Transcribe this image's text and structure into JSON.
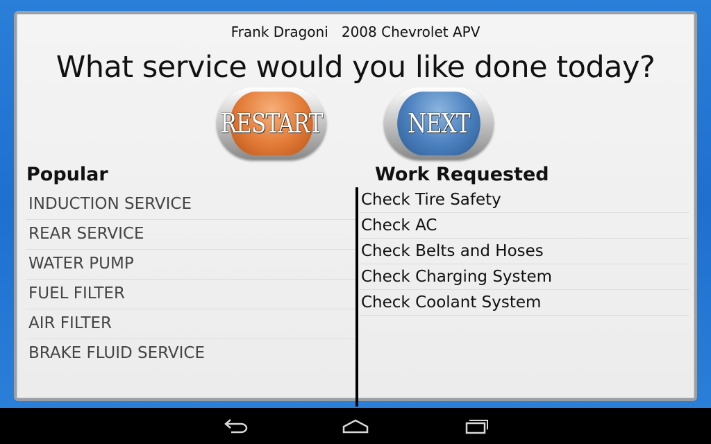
{
  "header": {
    "customer_name": "Frank Dragoni",
    "vehicle": "2008 Chevrolet APV",
    "question": "What service would you like done today?"
  },
  "buttons": {
    "restart_label": "RESTART",
    "next_label": "NEXT"
  },
  "popular": {
    "heading": "Popular",
    "items": [
      "INDUCTION SERVICE",
      "REAR SERVICE",
      "WATER PUMP",
      "FUEL FILTER",
      "AIR FILTER",
      "BRAKE FLUID SERVICE"
    ]
  },
  "work_requested": {
    "heading": "Work Requested",
    "items": [
      "Check Tire Safety",
      "Check AC",
      "Check Belts and Hoses",
      "Check Charging System",
      "Check Coolant System"
    ]
  },
  "navbar": {
    "icons": [
      "back-icon",
      "home-icon",
      "recent-apps-icon"
    ]
  },
  "colors": {
    "frame_blue": "#2a7fd9",
    "restart_orange": "#e37a37",
    "next_blue": "#4a7fbe"
  }
}
